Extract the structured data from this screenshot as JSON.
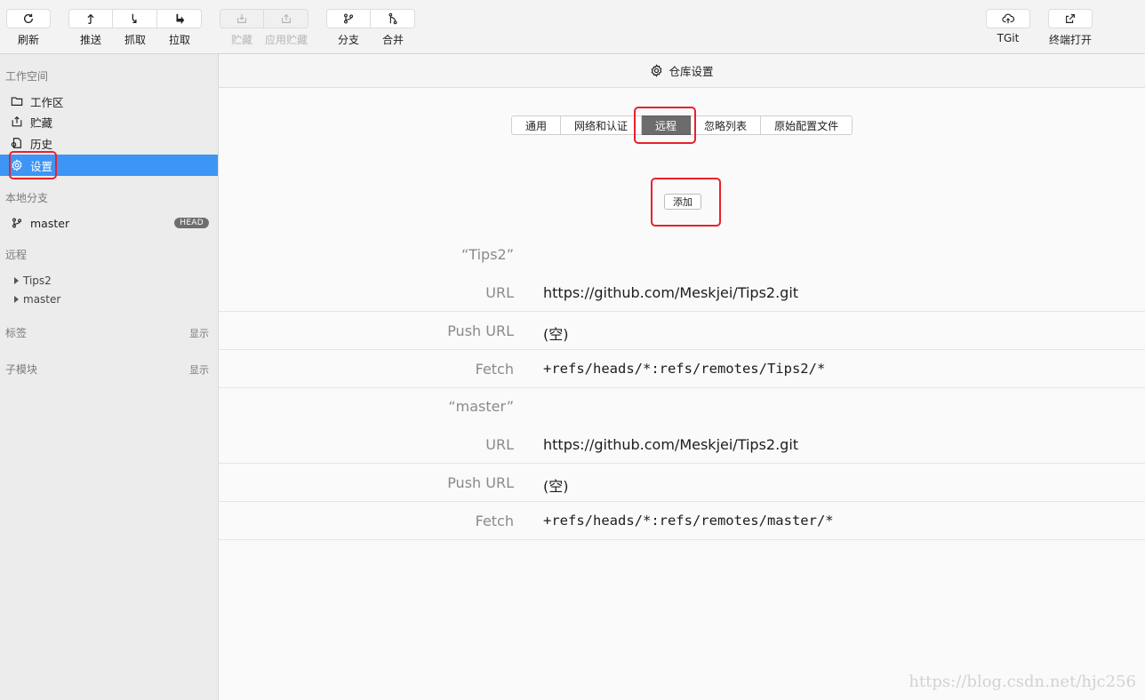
{
  "toolbar": {
    "refresh": "刷新",
    "push": "推送",
    "fetch": "抓取",
    "pull": "拉取",
    "stash": "贮藏",
    "apply_stash": "应用贮藏",
    "branch": "分支",
    "merge": "合并",
    "tgit": "TGit",
    "terminal": "终端打开"
  },
  "sidebar": {
    "workspace_title": "工作空间",
    "items": [
      {
        "label": "工作区"
      },
      {
        "label": "贮藏"
      },
      {
        "label": "历史"
      },
      {
        "label": "设置"
      }
    ],
    "local_branches_title": "本地分支",
    "branch": {
      "label": "master",
      "badge": "HEAD"
    },
    "remotes_title": "远程",
    "remotes": [
      {
        "label": "Tips2"
      },
      {
        "label": "master"
      }
    ],
    "tags_title": "标签",
    "tags_show": "显示",
    "submodules_title": "子模块",
    "submodules_show": "显示"
  },
  "main": {
    "header_title": "仓库设置",
    "tabs": [
      {
        "label": "通用"
      },
      {
        "label": "网络和认证"
      },
      {
        "label": "远程"
      },
      {
        "label": "忽略列表"
      },
      {
        "label": "原始配置文件"
      }
    ],
    "active_tab": "远程",
    "add_button": "添加",
    "remotes": [
      {
        "name": "“Tips2”",
        "url_label": "URL",
        "url": "https://github.com/Meskjei/Tips2.git",
        "push_url_label": "Push URL",
        "push_url": "(空)",
        "fetch_label": "Fetch",
        "fetch": "+refs/heads/*:refs/remotes/Tips2/*"
      },
      {
        "name": "“master”",
        "url_label": "URL",
        "url": "https://github.com/Meskjei/Tips2.git",
        "push_url_label": "Push URL",
        "push_url": "(空)",
        "fetch_label": "Fetch",
        "fetch": "+refs/heads/*:refs/remotes/master/*"
      }
    ]
  },
  "watermark": "https://blog.csdn.net/hjc256",
  "colors": {
    "active_sidebar": "#3d95f5",
    "active_tab": "#6c6c6c",
    "highlight_box": "#e8212b"
  }
}
